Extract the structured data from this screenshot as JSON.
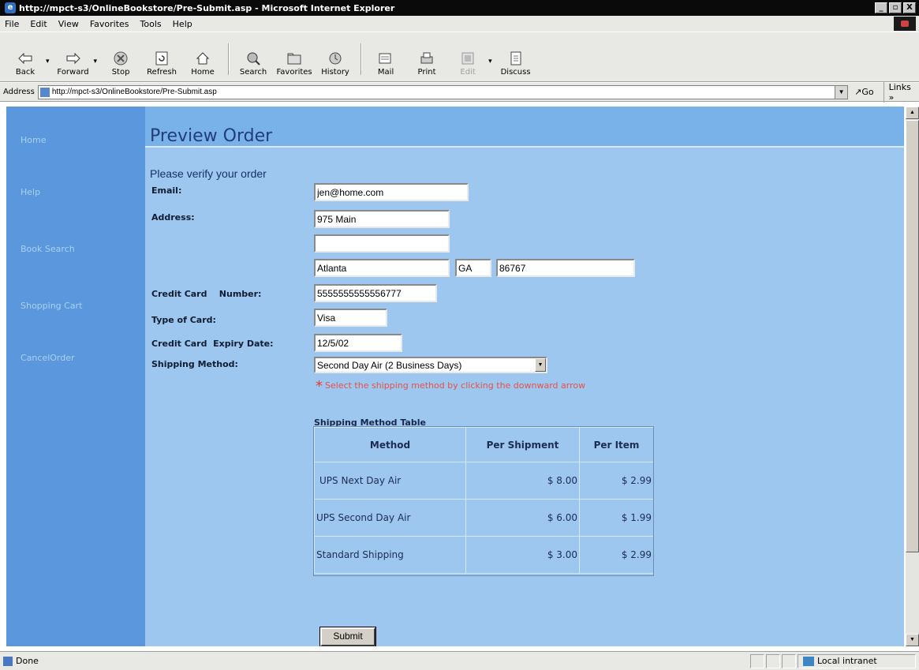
{
  "window": {
    "title": "http://mpct-s3/OnlineBookstore/Pre-Submit.asp - Microsoft Internet Explorer",
    "min": "_",
    "max": "▫",
    "close": "X"
  },
  "menu": [
    "File",
    "Edit",
    "View",
    "Favorites",
    "Tools",
    "Help"
  ],
  "toolbar": {
    "back": "Back",
    "forward": "Forward",
    "stop": "Stop",
    "refresh": "Refresh",
    "home": "Home",
    "search": "Search",
    "favorites": "Favorites",
    "history": "History",
    "mail": "Mail",
    "print": "Print",
    "edit": "Edit",
    "discuss": "Discuss"
  },
  "address": {
    "label": "Address",
    "url": "http://mpct-s3/OnlineBookstore/Pre-Submit.asp",
    "go": "Go",
    "links": "Links »"
  },
  "sidenav": [
    "Home",
    "Help",
    "Book Search",
    "Shopping Cart",
    "CancelOrder"
  ],
  "page": {
    "title": "Preview Order",
    "subtitle": "Please verify your order"
  },
  "form": {
    "email_label": "Email:",
    "email": "jen@home.com",
    "address_label": "Address:",
    "address1": "975 Main",
    "address2": "",
    "city": "Atlanta",
    "state": "GA",
    "zip": "86767",
    "cc_number_label": "Credit Card    Number:",
    "cc_number": "5555555555556777",
    "card_type_label": "Type of Card:",
    "card_type": "Visa",
    "expiry_label": "Credit Card  Expiry Date:",
    "expiry": "12/5/02",
    "shipping_label": "Shipping Method:",
    "shipping_selected": "Second Day Air (2 Business Days)",
    "shipping_note_star": "*",
    "shipping_note": "Select the shipping method by clicking the downward arrow",
    "submit": "Submit"
  },
  "shipping_table": {
    "caption": "Shipping Method Table",
    "headers": [
      "Method",
      "Per Shipment",
      "Per Item"
    ],
    "rows": [
      [
        "UPS Next Day Air",
        "$ 8.00",
        "$ 2.99"
      ],
      [
        "UPS Second Day Air",
        "$ 6.00",
        "$ 1.99"
      ],
      [
        "Standard Shipping",
        "$ 3.00",
        "$ 2.99"
      ]
    ]
  },
  "status": {
    "text": "Done",
    "zone": "Local intranet"
  },
  "colors": {
    "sidebar": "#5b97dc",
    "content": "#9dc7ef",
    "header": "#79b1e9",
    "note": "#e4524c"
  }
}
